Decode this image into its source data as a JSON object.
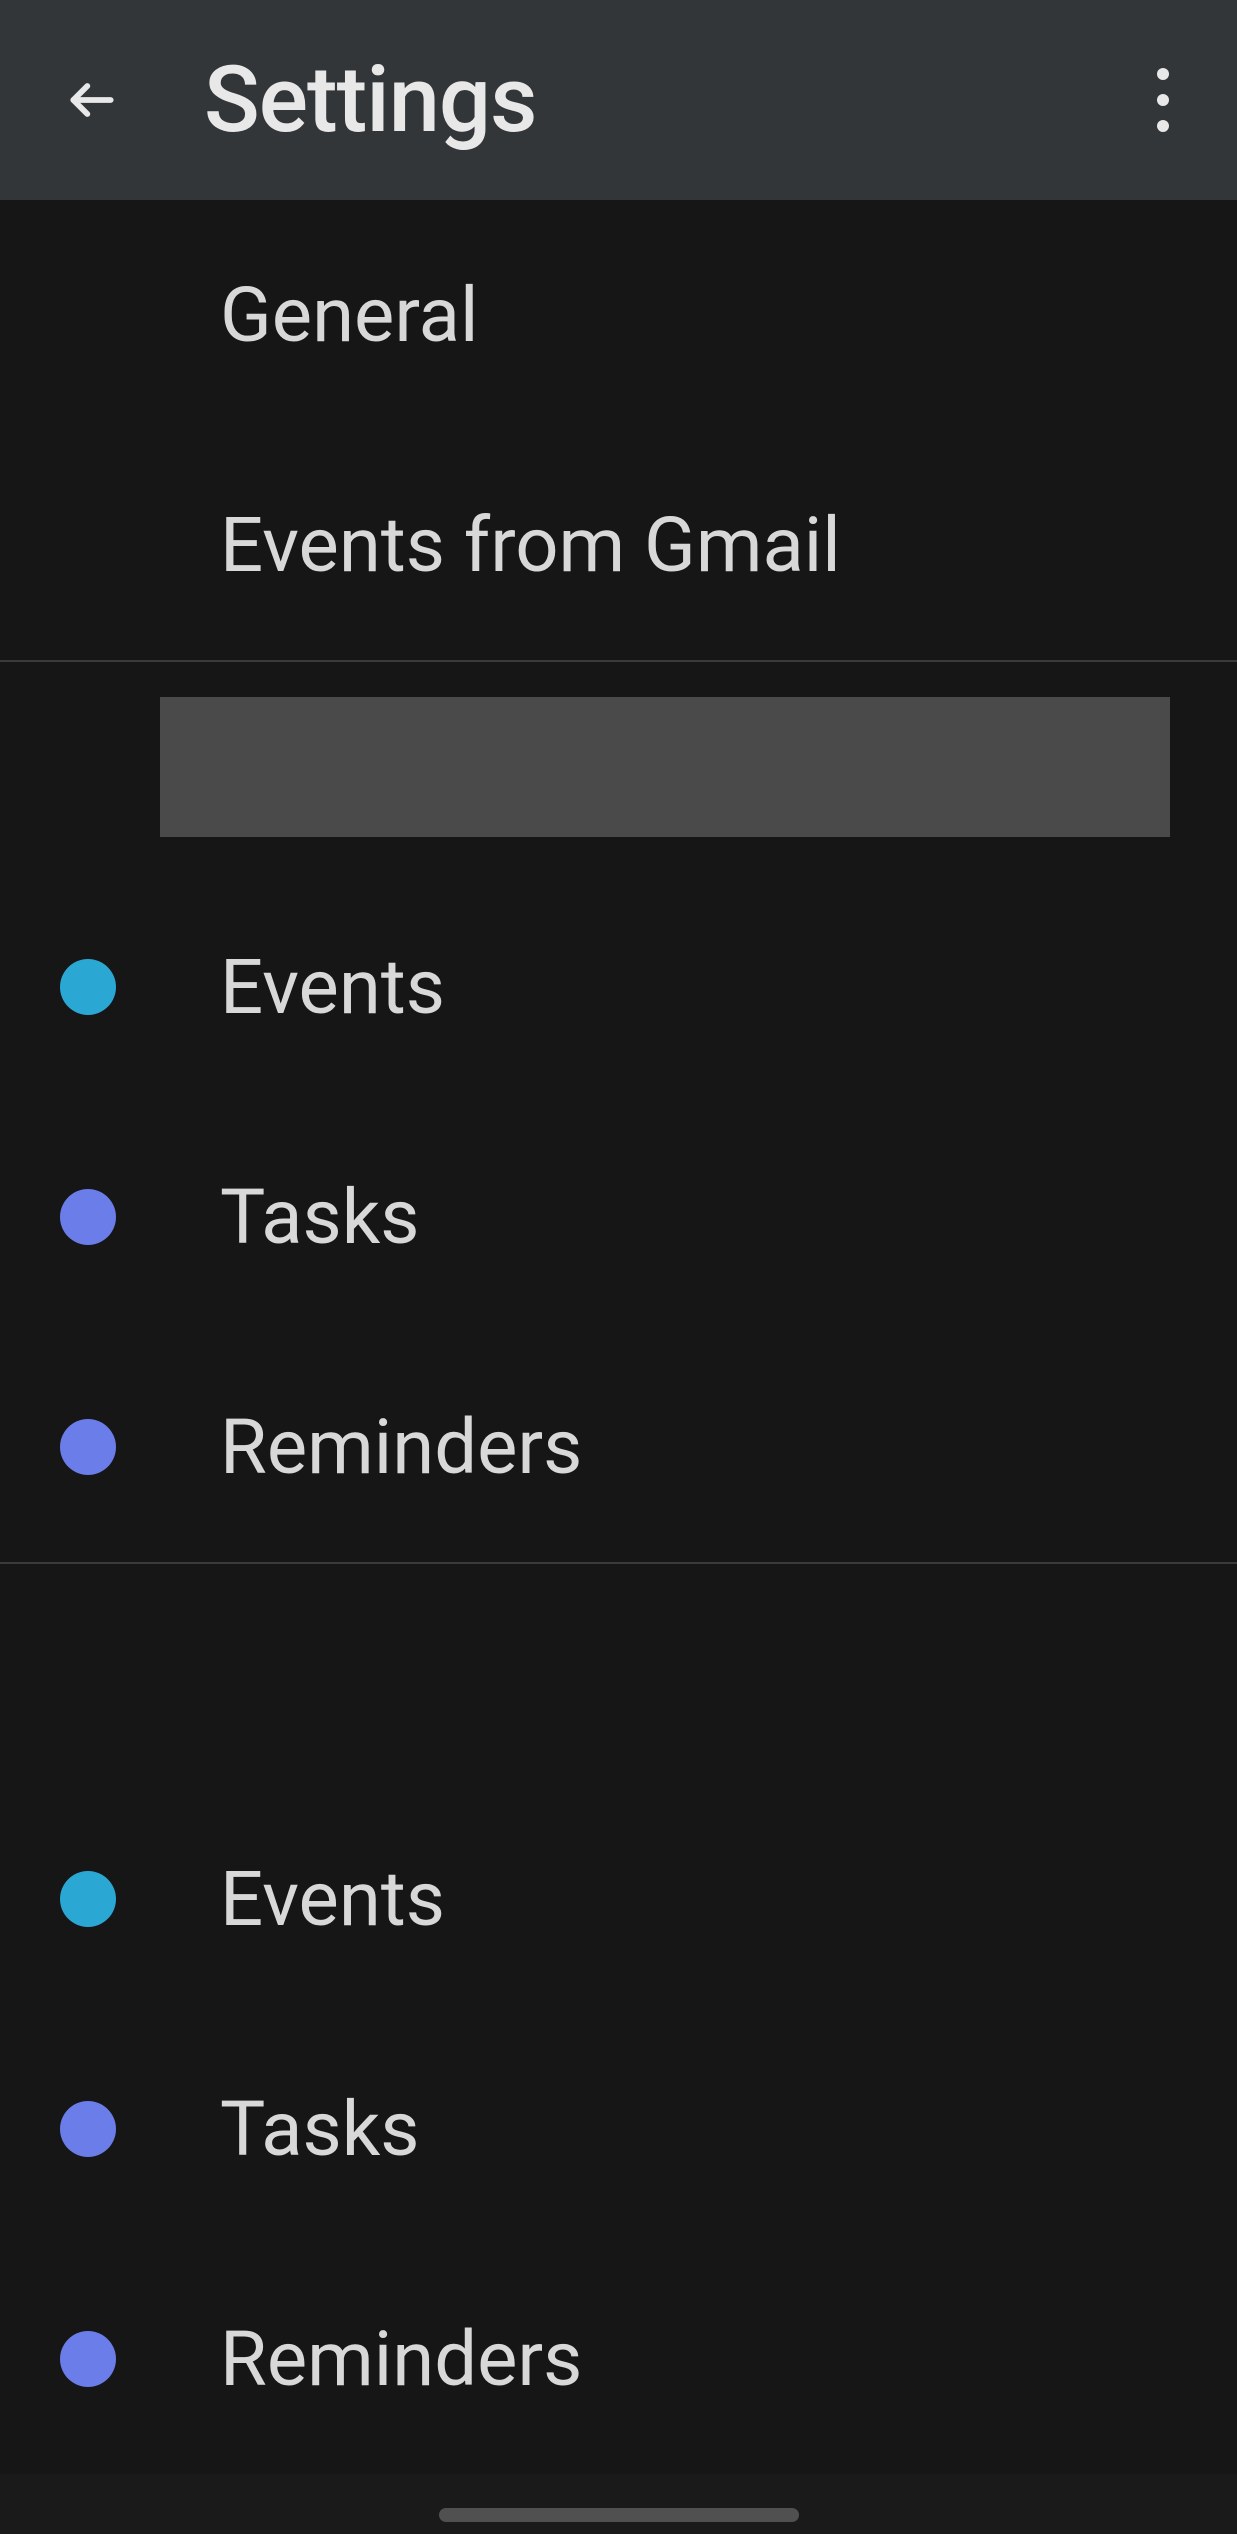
{
  "header": {
    "title": "Settings"
  },
  "topItems": [
    {
      "label": "General"
    },
    {
      "label": "Events from Gmail"
    }
  ],
  "accounts": [
    {
      "name": "",
      "calendars": [
        {
          "label": "Events",
          "color": "teal"
        },
        {
          "label": "Tasks",
          "color": "blue"
        },
        {
          "label": "Reminders",
          "color": "blue"
        }
      ]
    },
    {
      "name": "",
      "calendars": [
        {
          "label": "Events",
          "color": "teal"
        },
        {
          "label": "Tasks",
          "color": "blue"
        },
        {
          "label": "Reminders",
          "color": "blue"
        }
      ]
    }
  ]
}
